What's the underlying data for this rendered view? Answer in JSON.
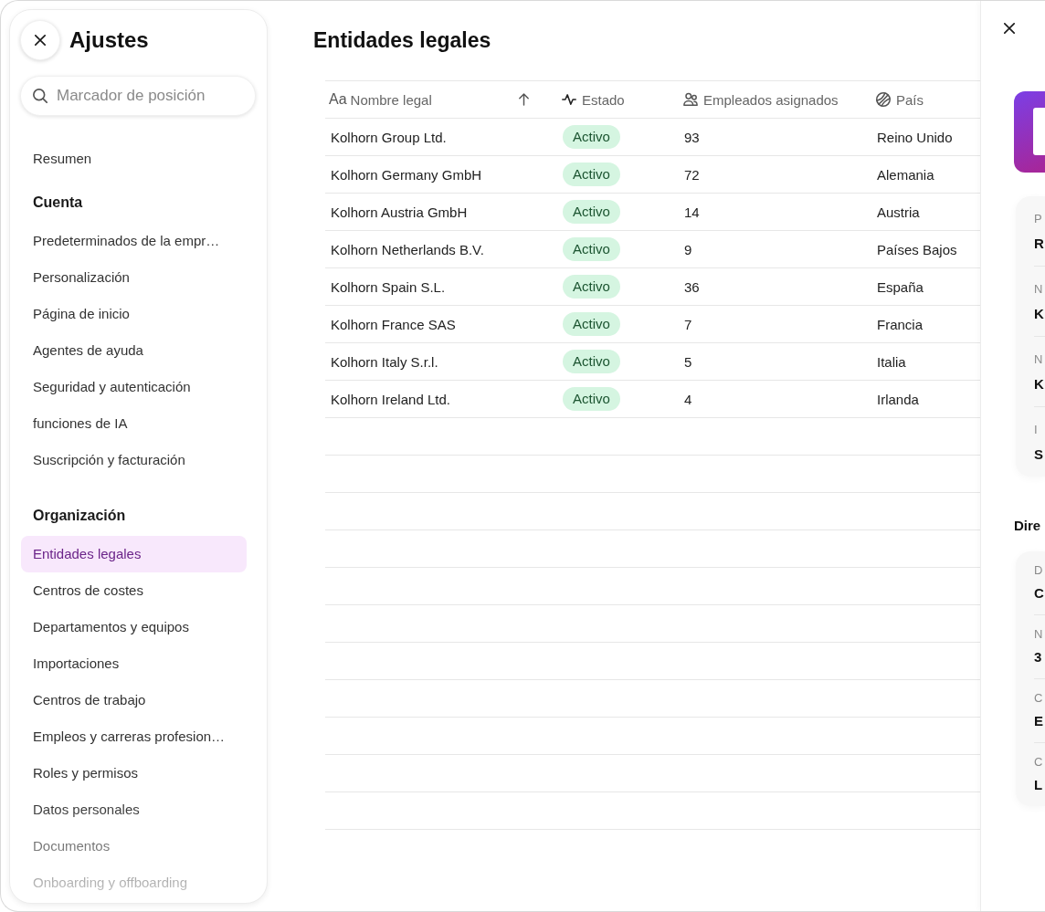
{
  "sidebar": {
    "title": "Ajustes",
    "search": {
      "placeholder": "Marcador de posición"
    },
    "sections": [
      {
        "items": [
          {
            "label": "Resumen",
            "selected": false
          }
        ]
      },
      {
        "heading": "Cuenta",
        "items": [
          {
            "label": "Predeterminados de la empr…",
            "selected": false
          },
          {
            "label": "Personalización",
            "selected": false
          },
          {
            "label": "Página de inicio",
            "selected": false
          },
          {
            "label": "Agentes de ayuda",
            "selected": false
          },
          {
            "label": "Seguridad y autenticación",
            "selected": false
          },
          {
            "label": "funciones de IA",
            "selected": false
          },
          {
            "label": "Suscripción y facturación",
            "selected": false
          }
        ]
      },
      {
        "heading": "Organización",
        "items": [
          {
            "label": "Entidades legales",
            "selected": true
          },
          {
            "label": "Centros de costes",
            "selected": false
          },
          {
            "label": "Departamentos y equipos",
            "selected": false
          },
          {
            "label": "Importaciones",
            "selected": false
          },
          {
            "label": "Centros de trabajo",
            "selected": false
          },
          {
            "label": "Empleos y carreras profesion…",
            "selected": false
          },
          {
            "label": "Roles y permisos",
            "selected": false
          },
          {
            "label": "Datos personales",
            "selected": false
          },
          {
            "label": "Documentos",
            "selected": false
          },
          {
            "label": "Onboarding y offboarding",
            "selected": false
          }
        ]
      }
    ]
  },
  "main": {
    "title": "Entidades legales",
    "table": {
      "columns": [
        {
          "glyph": "Aa",
          "label": "Nombre legal",
          "sorted": true
        },
        {
          "label": "Estado",
          "sorted": false
        },
        {
          "label": "Empleados asignados",
          "sorted": false
        },
        {
          "label": "País",
          "sorted": false
        }
      ],
      "rows": [
        {
          "name": "Kolhorn Group Ltd.",
          "status": "Activo",
          "employees": "93",
          "country": "Reino Unido"
        },
        {
          "name": "Kolhorn Germany GmbH",
          "status": "Activo",
          "employees": "72",
          "country": "Alemania"
        },
        {
          "name": "Kolhorn Austria GmbH",
          "status": "Activo",
          "employees": "14",
          "country": "Austria"
        },
        {
          "name": "Kolhorn Netherlands B.V.",
          "status": "Activo",
          "employees": "9",
          "country": "Países Bajos"
        },
        {
          "name": "Kolhorn Spain S.L.",
          "status": "Activo",
          "employees": "36",
          "country": "España"
        },
        {
          "name": "Kolhorn France SAS",
          "status": "Activo",
          "employees": "7",
          "country": "Francia"
        },
        {
          "name": "Kolhorn Italy S.r.l.",
          "status": "Activo",
          "employees": "5",
          "country": "Italia"
        },
        {
          "name": "Kolhorn Ireland Ltd.",
          "status": "Activo",
          "employees": "4",
          "country": "Irlanda"
        }
      ]
    }
  },
  "detail_panel": {
    "groups": [
      {
        "fields": [
          {
            "label": "P",
            "value": "R"
          },
          {
            "label": "N",
            "value": "K"
          },
          {
            "label": "N",
            "value": "K"
          },
          {
            "label": "I",
            "value": "S"
          }
        ]
      },
      {
        "heading": "Dire",
        "fields": [
          {
            "label": "D",
            "value": "C"
          },
          {
            "label": "N",
            "value": "3"
          },
          {
            "label": "C",
            "value": "E"
          },
          {
            "label": "C",
            "value": "L"
          }
        ]
      }
    ]
  }
}
